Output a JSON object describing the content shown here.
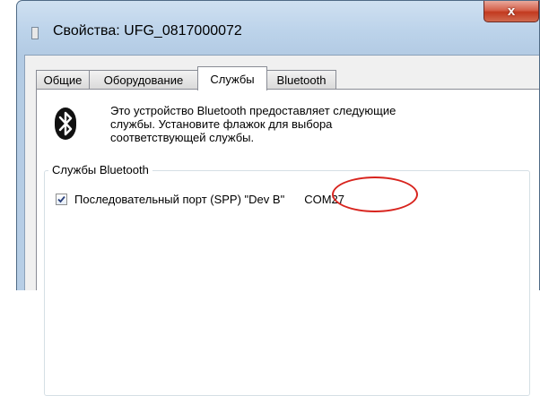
{
  "window": {
    "title": "Свойства: UFG_0817000072",
    "close_glyph": "x"
  },
  "tabs": [
    {
      "label": "Общие",
      "active": false
    },
    {
      "label": "Оборудование",
      "active": false
    },
    {
      "label": "Службы",
      "active": true
    },
    {
      "label": "Bluetooth",
      "active": false
    }
  ],
  "panel": {
    "icon": "bluetooth-icon",
    "description": [
      "Это устройство Bluetooth предоставляет следующие",
      "службы. Установите флажок для выбора",
      "соответствующей службы."
    ],
    "group_title": "Службы Bluetooth",
    "services": [
      {
        "label": "Последовательный порт (SPP) \"Dev B\"",
        "checked": true,
        "port": "COM27"
      }
    ]
  },
  "colors": {
    "annotation_circle": "#d8241e",
    "close_button": "#c2391f"
  }
}
